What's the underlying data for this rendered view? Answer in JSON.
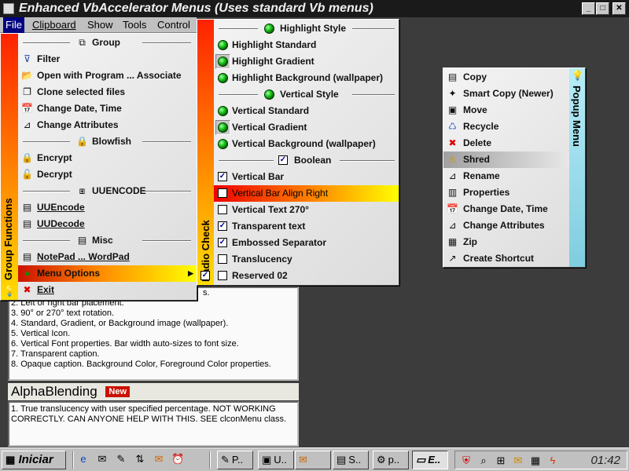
{
  "window": {
    "title": "Enhanced VbAccelerator Menus (Uses standard Vb menus)",
    "buttons": [
      "_",
      "□",
      "✕"
    ]
  },
  "menubar": {
    "items": [
      {
        "label": "File"
      },
      {
        "label": "Clipboard"
      },
      {
        "label": "Show"
      },
      {
        "label": "Tools"
      },
      {
        "label": "Control"
      }
    ]
  },
  "info_panel": {
    "lines": [
      "s.",
      "2. Left or right bar placement.",
      "3. 90° or 270° text rotation.",
      "4. Standard, Gradient, or Background image (wallpaper).",
      "5. Vertical Icon.",
      "6. Vertical Font properties. Bar width auto-sizes to font size.",
      "7. Transparent caption.",
      "8. Opaque caption. Background Color, Foreground Color properties."
    ]
  },
  "alphablending": {
    "title": "AlphaBlending",
    "badge": "New",
    "lines": [
      "1. True translucency with user specified percentage. NOT WORKING",
      "CORRECTLY. CAN ANYONE HELP WITH THIS. SEE clconMenu class."
    ]
  },
  "file_menu": {
    "bar_label": "Group Functions",
    "bar_icon": "lightbulb-icon",
    "items": [
      {
        "type": "separator",
        "label": "Group",
        "icon": "group-icon"
      },
      {
        "type": "item",
        "label": "Filter",
        "icon": "filter-icon"
      },
      {
        "type": "item",
        "label": "Open with Program ... Associate",
        "icon": "folder-open-icon"
      },
      {
        "type": "item",
        "label": "Clone selected files",
        "icon": "clone-icon"
      },
      {
        "type": "item",
        "label": "Change Date, Time",
        "icon": "calendar-icon"
      },
      {
        "type": "item",
        "label": "Change Attributes",
        "icon": "attributes-icon"
      },
      {
        "type": "separator",
        "label": "Blowfish",
        "icon": "lock-icon"
      },
      {
        "type": "item",
        "label": "Encrypt",
        "icon": "encrypt-lock-icon"
      },
      {
        "type": "item",
        "label": "Decrypt",
        "icon": "decrypt-lock-icon"
      },
      {
        "type": "separator",
        "label": "UUENCODE",
        "icon": "uuencode-icon"
      },
      {
        "type": "item",
        "label": "UUEncode",
        "icon": "uuencode-doc-icon"
      },
      {
        "type": "item",
        "label": "UUDecode",
        "icon": "uudecode-doc-icon"
      },
      {
        "type": "separator",
        "label": "Misc",
        "icon": "notepad-icon"
      },
      {
        "type": "item",
        "label": "NotePad ... WordPad",
        "icon": "wordpad-icon"
      },
      {
        "type": "item",
        "label": "Menu Options",
        "icon": "menu-options-icon",
        "highlighted": true,
        "submenu": true
      },
      {
        "type": "item",
        "label": "Exit",
        "icon": "exit-icon"
      }
    ]
  },
  "options_menu": {
    "bar_label": "Radio Check",
    "items": [
      {
        "type": "separator",
        "label": "Highlight Style",
        "marker": "radio"
      },
      {
        "type": "radio",
        "label": "Highlight Standard",
        "checked": false
      },
      {
        "type": "radio",
        "label": "Highlight Gradient",
        "checked": true
      },
      {
        "type": "radio",
        "label": "Highlight Background (wallpaper)",
        "checked": false
      },
      {
        "type": "separator",
        "label": "Vertical Style",
        "marker": "radio"
      },
      {
        "type": "radio",
        "label": "Vertical Standard",
        "checked": false
      },
      {
        "type": "radio",
        "label": "Vertical Gradient",
        "checked": true
      },
      {
        "type": "radio",
        "label": "Vertical Background (wallpaper)",
        "checked": false
      },
      {
        "type": "separator",
        "label": "Boolean",
        "marker": "check"
      },
      {
        "type": "check",
        "label": "Vertical Bar",
        "checked": true
      },
      {
        "type": "check",
        "label": "Vertical Bar Align Right",
        "checked": false,
        "highlighted": true
      },
      {
        "type": "check",
        "label": "Vertical Text 270°",
        "checked": false
      },
      {
        "type": "check",
        "label": "Transparent text",
        "checked": true
      },
      {
        "type": "check",
        "label": "Embossed Separator",
        "checked": true
      },
      {
        "type": "check",
        "label": "Translucency",
        "checked": false
      },
      {
        "type": "check",
        "label": "Reserved 02",
        "checked": false
      }
    ]
  },
  "popup_menu": {
    "bar_label": "Popup Menu",
    "bar_icon": "lightbulb-icon",
    "items": [
      {
        "label": "Copy",
        "icon": "copy-icon"
      },
      {
        "label": "Smart Copy (Newer)",
        "icon": "smart-copy-icon"
      },
      {
        "label": "Move",
        "icon": "move-icon"
      },
      {
        "label": "Recycle",
        "icon": "recycle-icon"
      },
      {
        "label": "Delete",
        "icon": "delete-icon"
      },
      {
        "label": "Shred",
        "icon": "warning-icon",
        "highlighted": true
      },
      {
        "label": "Rename",
        "icon": "rename-icon"
      },
      {
        "label": "Properties",
        "icon": "properties-icon"
      },
      {
        "label": "Change Date, Time",
        "icon": "calendar-icon"
      },
      {
        "label": "Change Attributes",
        "icon": "attributes-icon"
      },
      {
        "label": "Zip",
        "icon": "zip-icon"
      },
      {
        "label": "Create Shortcut",
        "icon": "shortcut-icon"
      }
    ]
  },
  "taskbar": {
    "start_label": "Iniciar",
    "quick_launch": [
      "ie-icon",
      "outlook-icon",
      "shell-icon",
      "ftp-icon",
      "mail-icon",
      "clock-app-icon"
    ],
    "tasks": [
      {
        "label": "P..",
        "icon": "paint-icon"
      },
      {
        "label": "U..",
        "icon": "vb-icon"
      },
      {
        "label": "",
        "icon": "email-task-icon"
      },
      {
        "label": "S..",
        "icon": "script-icon"
      },
      {
        "label": "p..",
        "icon": "program-icon"
      },
      {
        "label": "E..",
        "icon": "explorer-icon",
        "active": true
      }
    ],
    "tray_icons": [
      "antivirus-icon",
      "magnifier-icon",
      "network-icon",
      "mail-tray-icon",
      "display-icon",
      "power-icon"
    ],
    "clock": "01:42"
  },
  "colors": {
    "background": "#3c3c3c",
    "highlight_start": "#cc1100",
    "highlight_end": "#ffff00",
    "popup_bar": "#9edcea"
  }
}
